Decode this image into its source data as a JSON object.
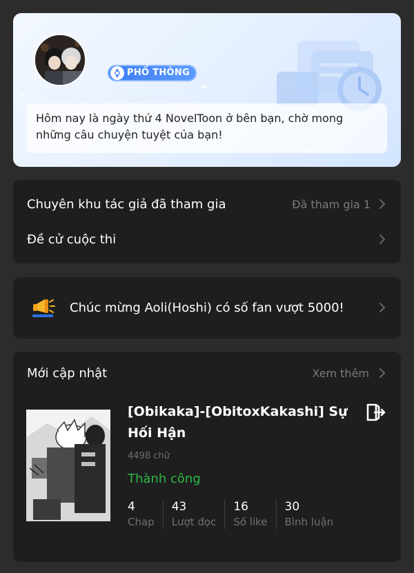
{
  "profile": {
    "level_badge": "PHỔ THÔNG",
    "welcome_text": "Hôm nay là ngày thứ 4 NovelToon ở bên bạn, chờ mong những câu chuyện tuyệt của bạn!"
  },
  "menu": {
    "items": [
      {
        "label": "Chuyên khu tác giả đã tham gia",
        "value": "Đã tham gia 1"
      },
      {
        "label": "Đề cử cuộc thi",
        "value": ""
      }
    ]
  },
  "announcement": {
    "icon": "megaphone-icon",
    "text": "Chúc mừng Aoli(Hoshi) có số fan vượt 5000!"
  },
  "updates": {
    "title": "Mới cập nhật",
    "see_more": "Xem thêm",
    "work": {
      "title": "[Obikaka]-[ObitoxKakashi] Sự Hối Hận",
      "word_count": "4498 chữ",
      "status": "Thành công",
      "stats": [
        {
          "value": "4",
          "label": "Chap"
        },
        {
          "value": "43",
          "label": "Lượt đọc"
        },
        {
          "value": "16",
          "label": "Số like"
        },
        {
          "value": "30",
          "label": "Bình luận"
        }
      ]
    }
  },
  "colors": {
    "background": "#2c2c2c",
    "card": "#1e1e1e",
    "status_green": "#2cb743",
    "badge_blue": "#3e7df3",
    "muted_text": "#7a7a7a"
  }
}
